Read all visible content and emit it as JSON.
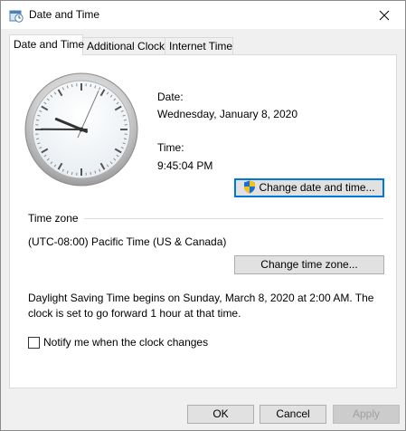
{
  "window": {
    "title": "Date and Time",
    "icon": "clock-calendar-icon"
  },
  "tabs": [
    {
      "label": "Date and Time",
      "active": true
    },
    {
      "label": "Additional Clocks",
      "active": false
    },
    {
      "label": "Internet Time",
      "active": false
    }
  ],
  "date": {
    "label": "Date:",
    "value": "Wednesday, January 8, 2020"
  },
  "time": {
    "label": "Time:",
    "value": "9:45:04 PM"
  },
  "clock": {
    "hours": 9,
    "minutes": 45,
    "seconds": 4
  },
  "change_datetime_button": "Change date and time...",
  "timezone": {
    "section_label": "Time zone",
    "value": "(UTC-08:00) Pacific Time (US & Canada)",
    "change_button": "Change time zone..."
  },
  "dst": {
    "line1": "Daylight Saving Time begins on Sunday, March 8, 2020 at 2:00 AM. The",
    "line2": "clock is set to go forward 1 hour at that time."
  },
  "notify_checkbox": {
    "label": "Notify me when the clock changes",
    "checked": false
  },
  "footer": {
    "ok": "OK",
    "cancel": "Cancel",
    "apply": "Apply"
  },
  "colors": {
    "focus": "#0078d7",
    "shield_blue": "#1c6fd1",
    "shield_yellow": "#f2c21b"
  }
}
